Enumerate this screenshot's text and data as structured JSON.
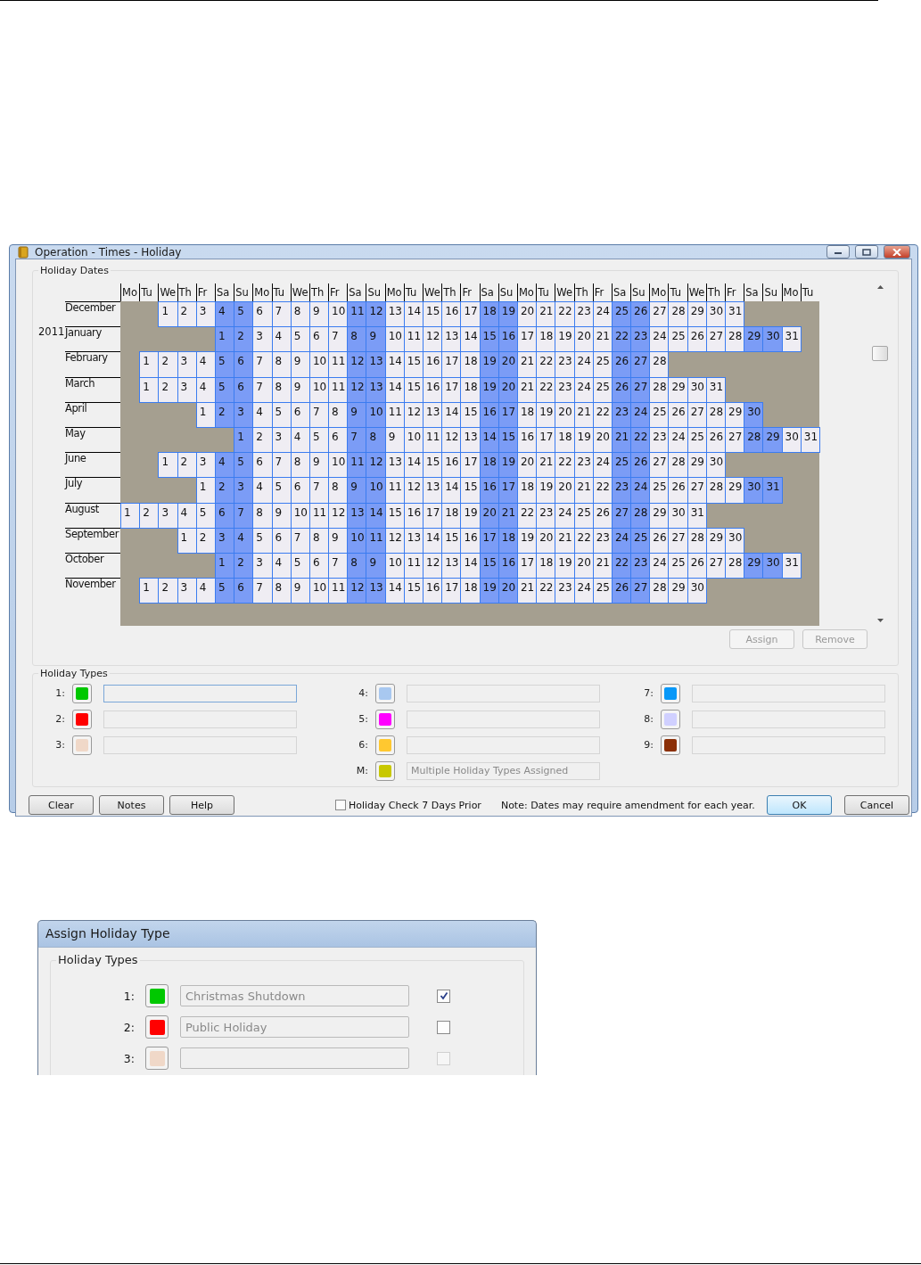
{
  "window": {
    "title": "Operation - Times - Holiday"
  },
  "holiday_dates": {
    "title": "Holiday Dates",
    "headers": [
      {
        "label": "Mo",
        "weekend": false
      },
      {
        "label": "Tu",
        "weekend": false
      },
      {
        "label": "We",
        "weekend": false
      },
      {
        "label": "Th",
        "weekend": false
      },
      {
        "label": "Fr",
        "weekend": false
      },
      {
        "label": "Sa",
        "weekend": true
      },
      {
        "label": "Su",
        "weekend": true
      },
      {
        "label": "Mo",
        "weekend": false
      },
      {
        "label": "Tu",
        "weekend": false
      },
      {
        "label": "We",
        "weekend": false
      },
      {
        "label": "Th",
        "weekend": false
      },
      {
        "label": "Fr",
        "weekend": false
      },
      {
        "label": "Sa",
        "weekend": true
      },
      {
        "label": "Su",
        "weekend": true
      },
      {
        "label": "Mo",
        "weekend": false
      },
      {
        "label": "Tu",
        "weekend": false
      },
      {
        "label": "We",
        "weekend": false
      },
      {
        "label": "Th",
        "weekend": false
      },
      {
        "label": "Fr",
        "weekend": false
      },
      {
        "label": "Sa",
        "weekend": true
      },
      {
        "label": "Su",
        "weekend": true
      },
      {
        "label": "Mo",
        "weekend": false
      },
      {
        "label": "Tu",
        "weekend": false
      },
      {
        "label": "We",
        "weekend": false
      },
      {
        "label": "Th",
        "weekend": false
      },
      {
        "label": "Fr",
        "weekend": false
      },
      {
        "label": "Sa",
        "weekend": true
      },
      {
        "label": "Su",
        "weekend": true
      },
      {
        "label": "Mo",
        "weekend": false
      },
      {
        "label": "Tu",
        "weekend": false
      },
      {
        "label": "We",
        "weekend": false
      },
      {
        "label": "Th",
        "weekend": false
      },
      {
        "label": "Fr",
        "weekend": false
      },
      {
        "label": "Sa",
        "weekend": true
      },
      {
        "label": "Su",
        "weekend": true
      },
      {
        "label": "Mo",
        "weekend": false
      },
      {
        "label": "Tu",
        "weekend": false
      }
    ],
    "months": [
      {
        "label": "December",
        "lead": [
          {
            "kind": "blank"
          },
          {
            "kind": "blank"
          }
        ],
        "days": [
          "1",
          "2",
          "3",
          "4",
          "5",
          "6",
          "7",
          "8",
          "9",
          "10",
          "11",
          "12",
          "13",
          "14",
          "15",
          "16",
          "17",
          "18",
          "19",
          "20",
          "21",
          "22",
          "23",
          "24",
          "25",
          "26",
          "27",
          "28",
          "29",
          "30",
          "31"
        ]
      },
      {
        "label": "January",
        "year": "2011",
        "lead": [
          {
            "kind": "blank"
          },
          {
            "kind": "blank"
          },
          {
            "kind": "blank"
          },
          {
            "kind": "blank"
          },
          {
            "kind": "blank"
          }
        ],
        "days": [
          "1",
          "2",
          "3",
          "4",
          "5",
          "6",
          "7",
          "8",
          "9",
          "10",
          "11",
          "12",
          "13",
          "14",
          "15",
          "16",
          "17",
          "18",
          "19",
          "20",
          "21",
          "22",
          "23",
          "24",
          "25",
          "26",
          "27",
          "28",
          "29",
          "30",
          "31"
        ]
      },
      {
        "label": "February",
        "lead": [
          {
            "kind": "blank"
          }
        ],
        "days": [
          "1",
          "2",
          "3",
          "4",
          "5",
          "6",
          "7",
          "8",
          "9",
          "10",
          "11",
          "12",
          "13",
          "14",
          "15",
          "16",
          "17",
          "18",
          "19",
          "20",
          "21",
          "22",
          "23",
          "24",
          "25",
          "26",
          "27",
          "28"
        ]
      },
      {
        "label": "March",
        "lead": [
          {
            "kind": "blank"
          }
        ],
        "days": [
          "1",
          "2",
          "3",
          "4",
          "5",
          "6",
          "7",
          "8",
          "9",
          "10",
          "11",
          "12",
          "13",
          "14",
          "15",
          "16",
          "17",
          "18",
          "19",
          "20",
          "21",
          "22",
          "23",
          "24",
          "25",
          "26",
          "27",
          "28",
          "29",
          "30",
          "31"
        ]
      },
      {
        "label": "April",
        "lead": [
          {
            "kind": "blank"
          },
          {
            "kind": "blank"
          },
          {
            "kind": "blank"
          },
          {
            "kind": "blank"
          }
        ],
        "days": [
          "1",
          "2",
          "3",
          "4",
          "5",
          "6",
          "7",
          "8",
          "9",
          "10",
          "11",
          "12",
          "13",
          "14",
          "15",
          "16",
          "17",
          "18",
          "19",
          "20",
          "21",
          "22",
          "23",
          "24",
          "25",
          "26",
          "27",
          "28",
          "29",
          "30"
        ]
      },
      {
        "label": "May",
        "lead": [
          {
            "kind": "blank"
          },
          {
            "kind": "blank"
          },
          {
            "kind": "blank"
          },
          {
            "kind": "blank"
          },
          {
            "kind": "blank"
          },
          {
            "kind": "blank"
          }
        ],
        "days": [
          "1",
          "2",
          "3",
          "4",
          "5",
          "6",
          "7",
          "8",
          "9",
          "10",
          "11",
          "12",
          "13",
          "14",
          "15",
          "16",
          "17",
          "18",
          "19",
          "20",
          "21",
          "22",
          "23",
          "24",
          "25",
          "26",
          "27",
          "28",
          "29",
          "30",
          "31"
        ]
      },
      {
        "label": "June",
        "lead": [
          {
            "kind": "blank"
          },
          {
            "kind": "blank"
          }
        ],
        "days": [
          "1",
          "2",
          "3",
          "4",
          "5",
          "6",
          "7",
          "8",
          "9",
          "10",
          "11",
          "12",
          "13",
          "14",
          "15",
          "16",
          "17",
          "18",
          "19",
          "20",
          "21",
          "22",
          "23",
          "24",
          "25",
          "26",
          "27",
          "28",
          "29",
          "30"
        ]
      },
      {
        "label": "July",
        "lead": [
          {
            "kind": "blank"
          },
          {
            "kind": "blank"
          },
          {
            "kind": "blank"
          },
          {
            "kind": "blank"
          }
        ],
        "days": [
          "1",
          "2",
          "3",
          "4",
          "5",
          "6",
          "7",
          "8",
          "9",
          "10",
          "11",
          "12",
          "13",
          "14",
          "15",
          "16",
          "17",
          "18",
          "19",
          "20",
          "21",
          "22",
          "23",
          "24",
          "25",
          "26",
          "27",
          "28",
          "29",
          "30",
          "31"
        ]
      },
      {
        "label": "August",
        "days": [
          "1",
          "2",
          "3",
          "4",
          "5",
          "6",
          "7",
          "8",
          "9",
          "10",
          "11",
          "12",
          "13",
          "14",
          "15",
          "16",
          "17",
          "18",
          "19",
          "20",
          "21",
          "22",
          "23",
          "24",
          "25",
          "26",
          "27",
          "28",
          "29",
          "30",
          "31"
        ]
      },
      {
        "label": "September",
        "lead": [
          {
            "kind": "blank"
          },
          {
            "kind": "blank"
          },
          {
            "kind": "blank"
          }
        ],
        "days": [
          "1",
          "2",
          "3",
          "4",
          "5",
          "6",
          "7",
          "8",
          "9",
          "10",
          "11",
          "12",
          "13",
          "14",
          "15",
          "16",
          "17",
          "18",
          "19",
          "20",
          "21",
          "22",
          "23",
          "24",
          "25",
          "26",
          "27",
          "28",
          "29",
          "30"
        ]
      },
      {
        "label": "October",
        "lead": [
          {
            "kind": "blank"
          },
          {
            "kind": "blank"
          },
          {
            "kind": "blank"
          },
          {
            "kind": "blank"
          },
          {
            "kind": "blank"
          }
        ],
        "days": [
          "1",
          "2",
          "3",
          "4",
          "5",
          "6",
          "7",
          "8",
          "9",
          "10",
          "11",
          "12",
          "13",
          "14",
          "15",
          "16",
          "17",
          "18",
          "19",
          "20",
          "21",
          "22",
          "23",
          "24",
          "25",
          "26",
          "27",
          "28",
          "29",
          "30",
          "31"
        ]
      },
      {
        "label": "November",
        "lead": [
          {
            "kind": "blank"
          }
        ],
        "days": [
          "1",
          "2",
          "3",
          "4",
          "5",
          "6",
          "7",
          "8",
          "9",
          "10",
          "11",
          "12",
          "13",
          "14",
          "15",
          "16",
          "17",
          "18",
          "19",
          "20",
          "21",
          "22",
          "23",
          "24",
          "25",
          "26",
          "27",
          "28",
          "29",
          "30"
        ]
      }
    ],
    "buttons": [
      {
        "label": "Assign",
        "disabled": true
      },
      {
        "label": "Remove",
        "disabled": true
      }
    ]
  },
  "holiday_types": {
    "title": "Holiday Types",
    "columns": [
      [
        {
          "label": "1:",
          "color": "#00c800"
        },
        {
          "label": "2:",
          "color": "#ff0000"
        },
        {
          "label": "3:",
          "color": "#f0d8c8"
        }
      ],
      [
        {
          "label": "4:",
          "color": "#a8c8f0"
        },
        {
          "label": "5:",
          "color": "#ff00ff"
        },
        {
          "label": "6:",
          "color": "#ffc830"
        },
        {
          "label": "M:",
          "color": "#c8c800",
          "value": "Multiple Holiday Types Assigned"
        }
      ],
      [
        {
          "label": "7:",
          "color": "#0898f8"
        },
        {
          "label": "8:",
          "color": "#d0d0ff"
        },
        {
          "label": "9:",
          "color": "#8b3008"
        }
      ]
    ]
  },
  "footer": {
    "left_buttons": [
      "Clear",
      "Notes",
      "Help"
    ],
    "checkbox": {
      "label": "Holiday Check 7 Days Prior",
      "checked": false
    },
    "note": "Note: Dates may require amendment for each year.",
    "right_buttons": [
      "OK",
      "Cancel"
    ]
  },
  "assign_dialog": {
    "title": "Assign Holiday Type",
    "group": "Holiday Types",
    "rows": [
      {
        "label": "1:",
        "color": "#00c800",
        "value": "Christmas Shutdown",
        "checked": true,
        "disabled": false
      },
      {
        "label": "2:",
        "color": "#ff0000",
        "value": "Public Holiday",
        "checked": false,
        "disabled": false
      },
      {
        "label": "3:",
        "color": "#f0d8c8",
        "checked": false,
        "disabled": true
      }
    ]
  }
}
